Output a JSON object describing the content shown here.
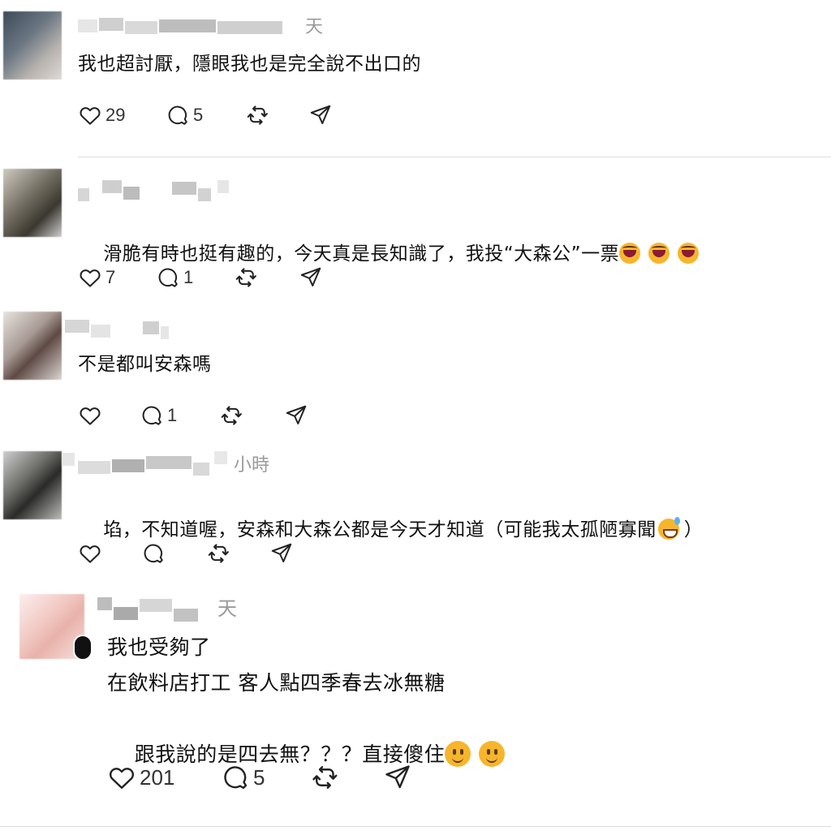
{
  "comments": [
    {
      "time": "天",
      "text": "我也超討厭，隱眼我也是完全說不出口的",
      "likes": "29",
      "replies": "5"
    },
    {
      "text": "滑脆有時也挺有趣的，今天真是長知識了，我投“大森公”一票",
      "emojis": [
        "rolling-laughing-emoji",
        "rolling-laughing-emoji",
        "rolling-laughing-emoji"
      ],
      "likes": "7",
      "replies": "1"
    },
    {
      "text": "不是都叫安森嗎",
      "likes": "",
      "replies": "1"
    },
    {
      "time": "小時",
      "text_before": "埳，不知道喔，安森和大森公都是今天才知道（可能我太孤陋寡聞",
      "text_after": "）",
      "emoji": "grinning-sweat-emoji",
      "likes": "",
      "replies": ""
    },
    {
      "time": "天",
      "lines": [
        "我也受夠了",
        "在飲料店打工 客人點四季春去冰無糖",
        "跟我說的是四去無？？？直接傻住"
      ],
      "emojis": [
        "slightly-smiling-emoji",
        "slightly-smiling-emoji"
      ],
      "likes": "201",
      "replies": "5"
    }
  ],
  "colors": {
    "icon": "#222222",
    "muted": "#9a9a9a",
    "divider": "#dcdcdc"
  }
}
